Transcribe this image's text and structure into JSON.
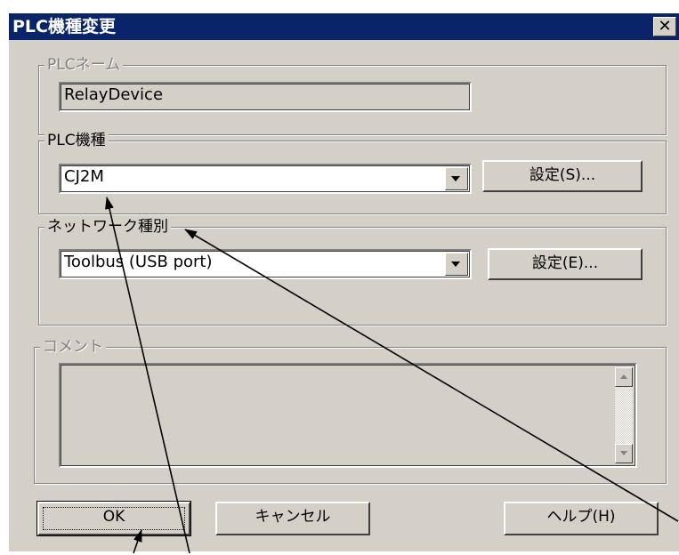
{
  "window": {
    "title": "PLC機種変更",
    "close_glyph": "✕"
  },
  "plc_name": {
    "label": "PLCネーム",
    "value": "RelayDevice"
  },
  "plc_model": {
    "label": "PLC機種",
    "value": "CJ2M",
    "settings_button": "設定(S)..."
  },
  "network": {
    "label": "ネットワーク種別",
    "value": "Toolbus (USB port)",
    "settings_button": "設定(E)..."
  },
  "comment": {
    "label": "コメント",
    "value": ""
  },
  "buttons": {
    "ok": "OK",
    "cancel": "キャンセル",
    "help": "ヘルプ(H)"
  }
}
